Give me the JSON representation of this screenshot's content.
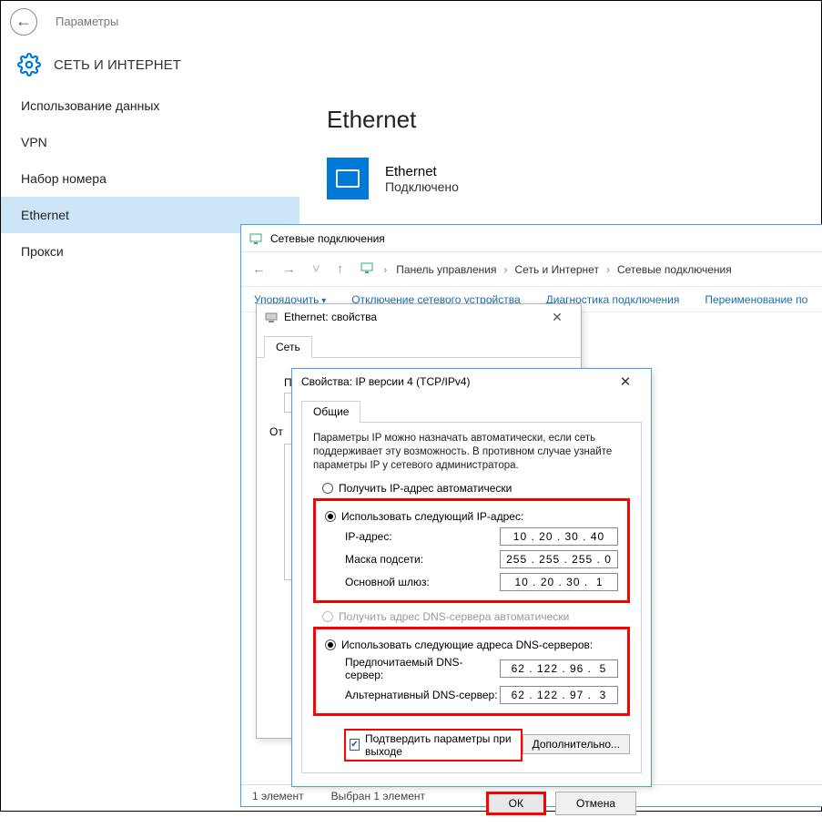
{
  "settings": {
    "app_title": "Параметры",
    "category": "СЕТЬ И ИНТЕРНЕТ",
    "sidebar": [
      {
        "label": "Использование данных"
      },
      {
        "label": "VPN"
      },
      {
        "label": "Набор номера"
      },
      {
        "label": "Ethernet"
      },
      {
        "label": "Прокси"
      }
    ],
    "page_heading": "Ethernet",
    "adapter": {
      "name": "Ethernet",
      "status": "Подключено"
    }
  },
  "explorer": {
    "title": "Сетевые подключения",
    "breadcrumbs": [
      "Панель управления",
      "Сеть и Интернет",
      "Сетевые подключения"
    ],
    "toolbar": {
      "organize": "Упорядочить",
      "disable": "Отключение сетевого устройства",
      "diagnose": "Диагностика подключения",
      "rename": "Переименование по"
    },
    "status_left": "1 элемент",
    "status_right": "Выбран 1 элемент"
  },
  "eth_dialog": {
    "title": "Ethernet: свойства",
    "tab": "Сеть",
    "connect_using_label": "По",
    "items_label": "От"
  },
  "ipv4": {
    "title": "Свойства: IP версии 4 (TCP/IPv4)",
    "tab": "Общие",
    "description": "Параметры IP можно назначать автоматически, если сеть поддерживает эту возможность. В противном случае узнайте параметры IP у сетевого администратора.",
    "radio_ip_auto": "Получить IP-адрес автоматически",
    "radio_ip_manual": "Использовать следующий IP-адрес:",
    "labels": {
      "ip": "IP-адрес:",
      "mask": "Маска подсети:",
      "gateway": "Основной шлюз:"
    },
    "values": {
      "ip": "10 . 20 . 30 . 40",
      "mask": "255 . 255 . 255 . 0",
      "gateway": "10 . 20 . 30 .  1"
    },
    "radio_dns_auto": "Получить адрес DNS-сервера автоматически",
    "radio_dns_manual": "Использовать следующие адреса DNS-серверов:",
    "dns_labels": {
      "preferred": "Предпочитаемый DNS-сервер:",
      "alternate": "Альтернативный DNS-сервер:"
    },
    "dns_values": {
      "preferred": "62 . 122 . 96 .  5",
      "alternate": "62 . 122 . 97 .  3"
    },
    "validate_label": "Подтвердить параметры при выходе",
    "advanced_button": "Дополнительно...",
    "ok_button": "ОК",
    "cancel_button": "Отмена"
  }
}
